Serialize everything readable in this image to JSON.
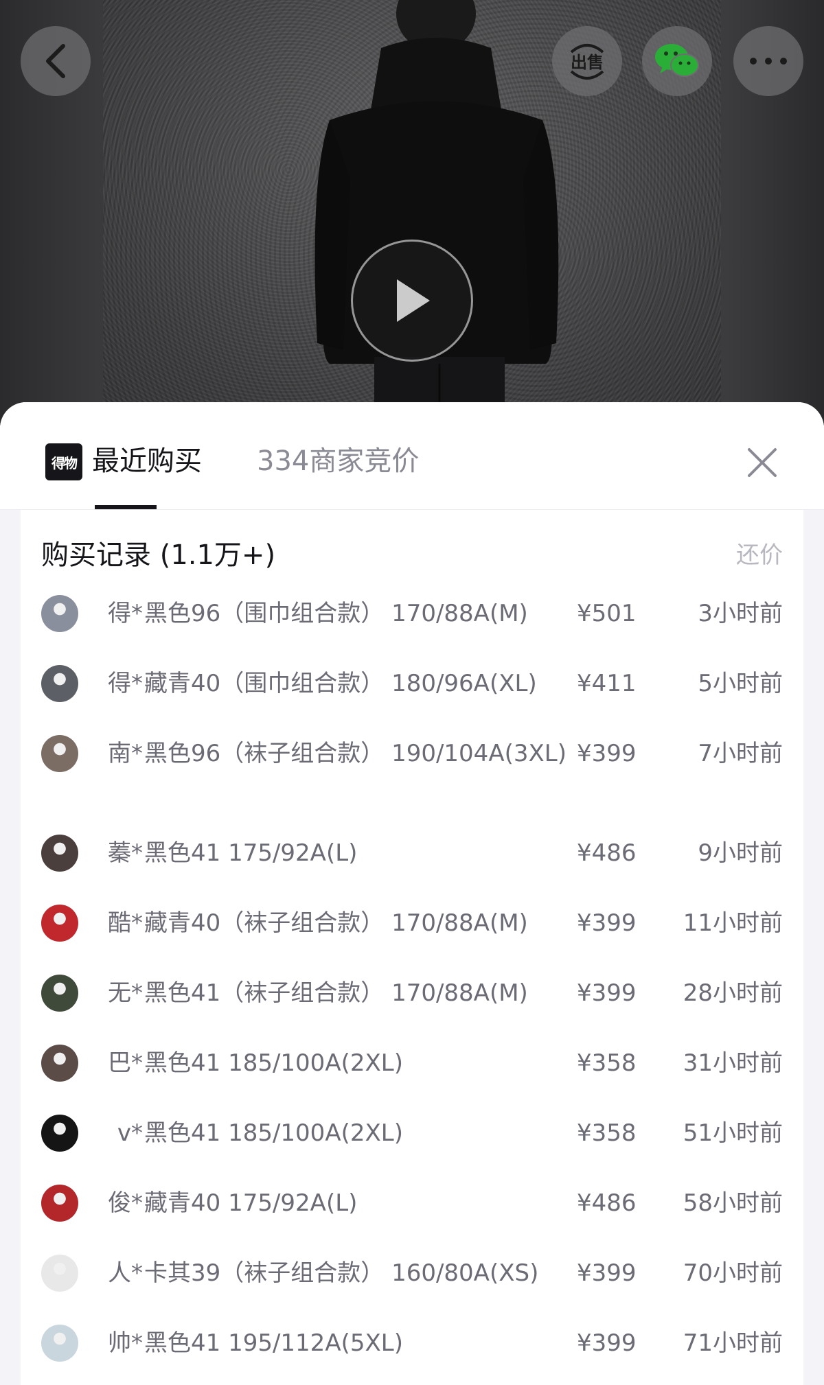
{
  "header": {
    "back_icon": "chevron-left-icon",
    "sell_label": "出售",
    "wechat_icon": "wechat-icon",
    "more_icon": "more-dots-icon",
    "play_icon": "play-icon"
  },
  "sheet": {
    "brand_logo_text": "得物",
    "tabs": [
      {
        "label": "最近购买",
        "active": true
      },
      {
        "label": "334商家竞价",
        "active": false
      }
    ],
    "close_icon": "close-icon"
  },
  "records": {
    "title": "购买记录 (1.1万+)",
    "bargain_label": "还价",
    "rows": [
      {
        "buyer": "得*",
        "spec": "黑色96（围巾组合款） 170/88A(M)",
        "price": "¥501",
        "time": "3小时前",
        "avatar_color": "#8a8f9e"
      },
      {
        "buyer": "得*",
        "spec": "藏青40（围巾组合款） 180/96A(XL)",
        "price": "¥411",
        "time": "5小时前",
        "avatar_color": "#5d5f66"
      },
      {
        "buyer": "南*",
        "spec": "黑色96（袜子组合款） 190/104A(3XL)",
        "price": "¥399",
        "time": "7小时前",
        "avatar_color": "#7b6c64"
      },
      {
        "buyer": "蓁*",
        "spec": "黑色41 175/92A(L)",
        "price": "¥486",
        "time": "9小时前",
        "avatar_color": "#4a3f3d"
      },
      {
        "buyer": "酷*",
        "spec": "藏青40（袜子组合款） 170/88A(M)",
        "price": "¥399",
        "time": "11小时前",
        "avatar_color": "#c0282d"
      },
      {
        "buyer": "无*",
        "spec": "黑色41（袜子组合款） 170/88A(M)",
        "price": "¥399",
        "time": "28小时前",
        "avatar_color": "#3f4a3a"
      },
      {
        "buyer": "巴*",
        "spec": "黑色41 185/100A(2XL)",
        "price": "¥358",
        "time": "31小时前",
        "avatar_color": "#5b4c47"
      },
      {
        "buyer": "v*",
        "spec": "黑色41 185/100A(2XL)",
        "price": "¥358",
        "time": "51小时前",
        "avatar_color": "#151515"
      },
      {
        "buyer": "俊*",
        "spec": "藏青40 175/92A(L)",
        "price": "¥486",
        "time": "58小时前",
        "avatar_color": "#b3262a"
      },
      {
        "buyer": "人*",
        "spec": "卡其39（袜子组合款） 160/80A(XS)",
        "price": "¥399",
        "time": "70小时前",
        "avatar_color": "#e8e8e8"
      },
      {
        "buyer": "帅*",
        "spec": "黑色41 195/112A(5XL)",
        "price": "¥399",
        "time": "71小时前",
        "avatar_color": "#c9d6de"
      }
    ]
  }
}
